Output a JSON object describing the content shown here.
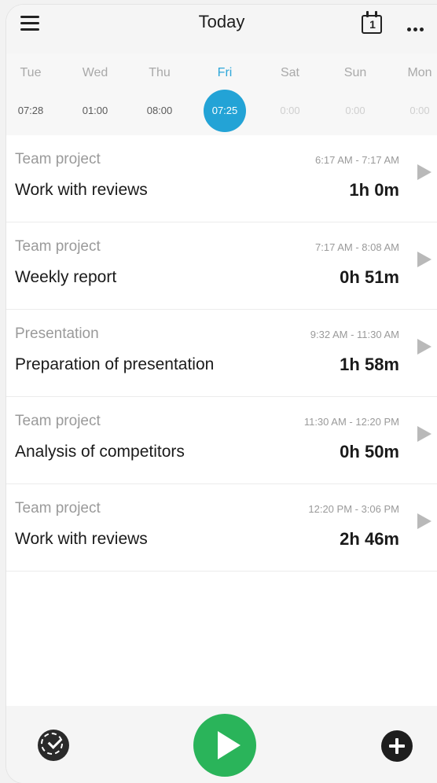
{
  "header": {
    "title": "Today",
    "calendar_day": "1"
  },
  "days": [
    {
      "name": "Tue",
      "time": "07:28"
    },
    {
      "name": "Wed",
      "time": "01:00"
    },
    {
      "name": "Thu",
      "time": "08:00"
    },
    {
      "name": "Fri",
      "time": "07:25"
    },
    {
      "name": "Sat",
      "time": "0:00"
    },
    {
      "name": "Sun",
      "time": "0:00"
    },
    {
      "name": "Mon",
      "time": "0:00"
    }
  ],
  "entries": [
    {
      "project": "Team project",
      "range": "6:17 AM - 7:17 AM",
      "task": "Work with reviews",
      "duration": "1h 0m"
    },
    {
      "project": "Team project",
      "range": "7:17 AM - 8:08 AM",
      "task": "Weekly report",
      "duration": "0h 51m"
    },
    {
      "project": "Presentation",
      "range": "9:32 AM - 11:30 AM",
      "task": "Preparation of presentation",
      "duration": "1h 58m"
    },
    {
      "project": "Team project",
      "range": "11:30 AM - 12:20 PM",
      "task": "Analysis of competitors",
      "duration": "0h 50m"
    },
    {
      "project": "Team project",
      "range": "12:20 PM - 3:06 PM",
      "task": "Work with reviews",
      "duration": "2h 46m"
    }
  ],
  "colors": {
    "accent": "#23a3d6",
    "start": "#2ab45a"
  },
  "icons": {
    "menu": "menu-icon",
    "calendar": "calendar-icon",
    "more": "more-icon",
    "goal": "goal-icon",
    "start": "play-icon",
    "add": "plus-icon"
  }
}
